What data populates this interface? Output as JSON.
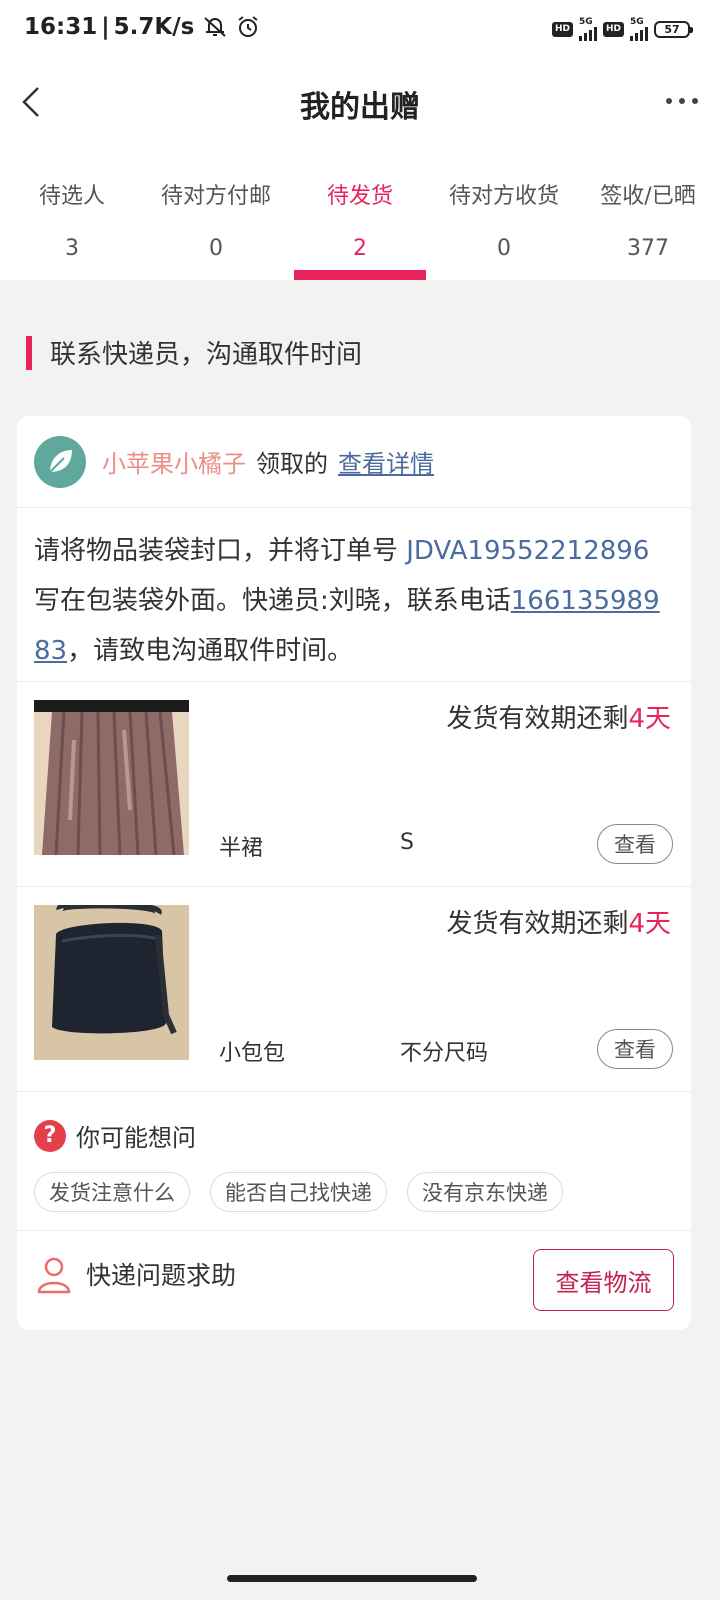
{
  "status": {
    "time": "16:31",
    "speed": "5.7K/s",
    "hd1": "HD",
    "net1": "5G",
    "hd2": "HD",
    "net2": "5G",
    "battery": "57"
  },
  "nav": {
    "title": "我的出赠"
  },
  "tabs": [
    {
      "label": "待选人",
      "count": "3"
    },
    {
      "label": "待对方付邮",
      "count": "0"
    },
    {
      "label": "待发货",
      "count": "2"
    },
    {
      "label": "待对方收货",
      "count": "0"
    },
    {
      "label": "签收/已晒",
      "count": "377"
    }
  ],
  "section": {
    "title": "联系快递员，沟通取件时间"
  },
  "card": {
    "recipient_name": "小苹果小橘子",
    "received_text": "领取的",
    "detail_link": "查看详情",
    "instruction": {
      "part1": "请将物品装袋封口，并将订单号 ",
      "order_no": "JDVA19552212896",
      "part2": " 写在包装袋外面。快递员:刘晓，联系电话",
      "phone": "16613598983",
      "part3": "，请致电沟通取件时间。"
    },
    "items": [
      {
        "deadline_prefix": "发货有效期还剩",
        "deadline_value": "4天",
        "name": "半裙",
        "size": "S",
        "view_label": "查看"
      },
      {
        "deadline_prefix": "发货有效期还剩",
        "deadline_value": "4天",
        "name": "小包包",
        "size": "不分尺码",
        "view_label": "查看"
      }
    ],
    "faq": {
      "title": "你可能想问",
      "chips": [
        "发货注意什么",
        "能否自己找快递",
        "没有京东快递"
      ]
    },
    "help": {
      "label": "快递问题求助",
      "logistics_button": "查看物流"
    }
  },
  "colors": {
    "accent": "#e8245c",
    "link": "#4a6c9e",
    "recipient": "#ec8f86"
  }
}
